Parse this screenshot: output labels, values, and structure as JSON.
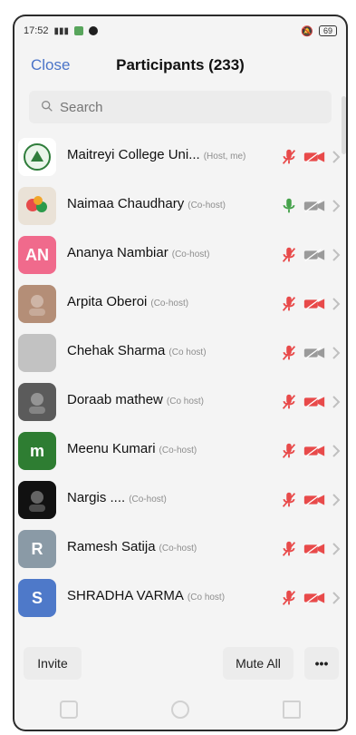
{
  "status_bar": {
    "time": "17:52",
    "battery": "69"
  },
  "header": {
    "close_label": "Close",
    "title": "Participants (233)"
  },
  "search": {
    "placeholder": "Search"
  },
  "participants": [
    {
      "name": "Maitreyi College Uni...",
      "role": "(Host, me)",
      "avatar_text": "",
      "avatar_color": "#ffffff",
      "avatar_icon": "college-logo-icon",
      "mic": "muted",
      "cam": "off"
    },
    {
      "name": "Naimaa Chaudhary",
      "role": "(Co-host)",
      "avatar_text": "",
      "avatar_color": "#eae2d7",
      "avatar_icon": "flower-photo-icon",
      "mic": "on",
      "cam": "off-grey"
    },
    {
      "name": "Ananya Nambiar",
      "role": "(Co-host)",
      "avatar_text": "AN",
      "avatar_color": "#f06a8c",
      "avatar_icon": "",
      "mic": "muted",
      "cam": "off-grey"
    },
    {
      "name": "Arpita Oberoi",
      "role": "(Co-host)",
      "avatar_text": "",
      "avatar_color": "#b48e77",
      "avatar_icon": "portrait-photo-icon",
      "mic": "muted",
      "cam": "off"
    },
    {
      "name": "Chehak Sharma",
      "role": "(Co host)",
      "avatar_text": "",
      "avatar_color": "#c2c2c2",
      "avatar_icon": "",
      "mic": "muted",
      "cam": "off-grey"
    },
    {
      "name": "Doraab mathew",
      "role": "(Co host)",
      "avatar_text": "",
      "avatar_color": "#5b5b5b",
      "avatar_icon": "portrait-photo-icon",
      "mic": "muted",
      "cam": "off"
    },
    {
      "name": "Meenu Kumari",
      "role": "(Co-host)",
      "avatar_text": "m",
      "avatar_color": "#2e7d32",
      "avatar_icon": "",
      "mic": "muted",
      "cam": "off"
    },
    {
      "name": "Nargis ....",
      "role": "(Co-host)",
      "avatar_text": "",
      "avatar_color": "#111111",
      "avatar_icon": "portrait-photo-icon",
      "mic": "muted",
      "cam": "off"
    },
    {
      "name": "Ramesh Satija",
      "role": "(Co-host)",
      "avatar_text": "R",
      "avatar_color": "#8a9aa6",
      "avatar_icon": "",
      "mic": "muted",
      "cam": "off"
    },
    {
      "name": "SHRADHA VARMA",
      "role": "(Co host)",
      "avatar_text": "S",
      "avatar_color": "#4e79c9",
      "avatar_icon": "",
      "mic": "muted",
      "cam": "off"
    }
  ],
  "bottom_bar": {
    "invite_label": "Invite",
    "mute_all_label": "Mute All",
    "more_label": "•••"
  },
  "colors": {
    "accent": "#4b74c8",
    "muted_red": "#e84a4a",
    "mic_green": "#45a24b",
    "cam_grey": "#9a9a9a"
  }
}
